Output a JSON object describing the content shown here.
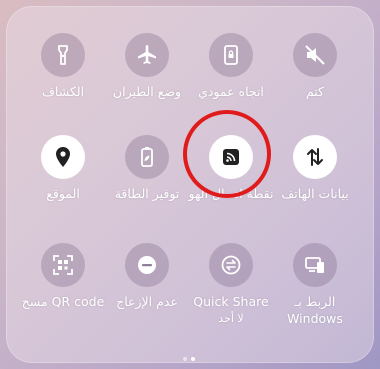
{
  "tiles": [
    {
      "key": "flashlight",
      "label": "الكشاف",
      "icon": "flashlight-icon",
      "active": false
    },
    {
      "key": "airplane",
      "label": "وضع الطيران",
      "icon": "airplane-icon",
      "active": false
    },
    {
      "key": "portrait",
      "label": "اتجاه عمودي",
      "icon": "portrait-lock-icon",
      "active": false
    },
    {
      "key": "mute",
      "label": "كتم",
      "icon": "mute-icon",
      "active": false
    },
    {
      "key": "location",
      "label": "الموقع",
      "icon": "location-pin-icon",
      "active": true
    },
    {
      "key": "power_saving",
      "label": "توفير الطاقة",
      "icon": "battery-leaf-icon",
      "active": false
    },
    {
      "key": "hotspot",
      "label": "نقطة اتصال الهو",
      "icon": "hotspot-icon",
      "active": true
    },
    {
      "key": "mobile_data",
      "label": "بيانات الهاتف",
      "icon": "mobile-data-icon",
      "active": true
    },
    {
      "key": "qr",
      "label": "مسح QR code",
      "icon": "qr-scan-icon",
      "active": false
    },
    {
      "key": "dnd",
      "label": "عدم الإزعاج",
      "icon": "do-not-disturb-icon",
      "active": false
    },
    {
      "key": "quick_share",
      "label": "Quick Share",
      "sublabel": "لا أحد",
      "icon": "quick-share-icon",
      "active": false
    },
    {
      "key": "windows",
      "label": "الربط بـ Windows",
      "icon": "link-to-windows-icon",
      "active": false
    }
  ],
  "pager": {
    "pages": 2,
    "current": 2
  },
  "colors": {
    "highlight_ring": "#e01b1b"
  }
}
